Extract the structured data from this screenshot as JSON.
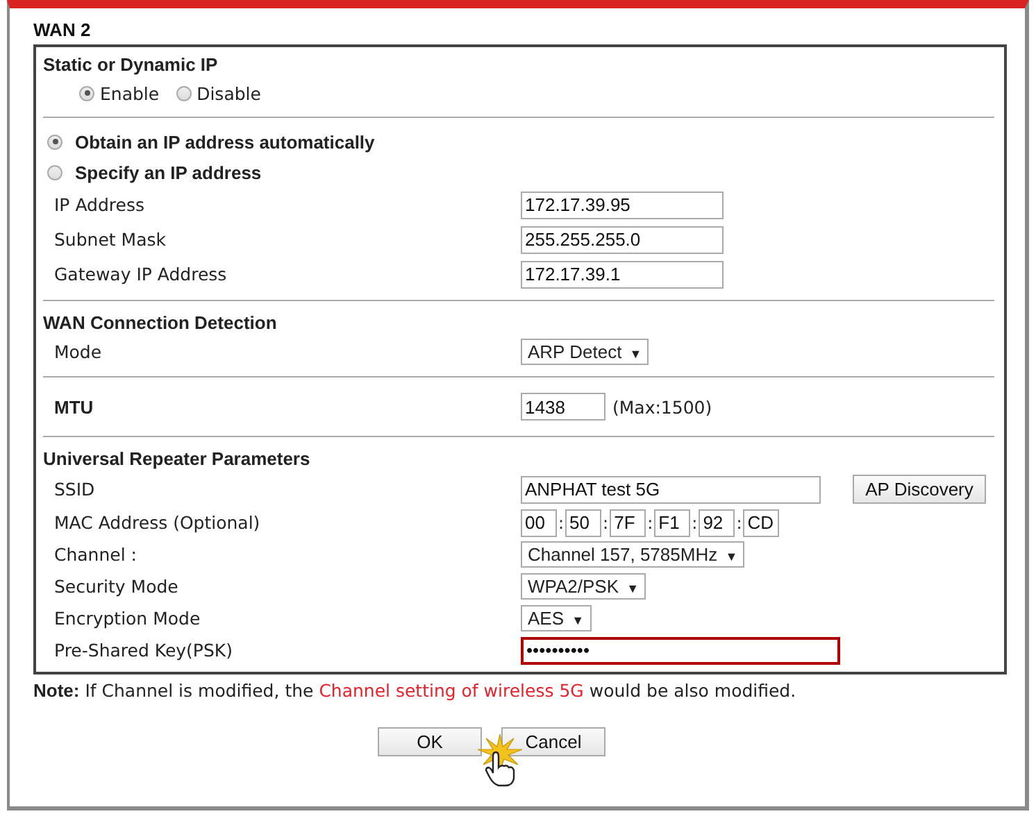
{
  "title": "WAN 2",
  "sections": [
    {
      "heading": "Static or Dynamic IP",
      "rows": [
        {
          "kind": "radio-group",
          "options": [
            {
              "label": "Enable",
              "selected": true
            },
            {
              "label": "Disable",
              "selected": false
            }
          ]
        }
      ]
    },
    {
      "rows": [
        {
          "kind": "radio",
          "label": "Obtain an IP address automatically",
          "selected": true
        },
        {
          "kind": "radio",
          "label": "Specify an IP address",
          "selected": false
        },
        {
          "kind": "text",
          "label": "IP Address",
          "value": "172.17.39.95"
        },
        {
          "kind": "text",
          "label": "Subnet Mask",
          "value": "255.255.255.0"
        },
        {
          "kind": "text",
          "label": "Gateway IP Address",
          "value": "172.17.39.1"
        }
      ]
    },
    {
      "heading": "WAN Connection Detection",
      "rows": [
        {
          "kind": "select",
          "label": "Mode",
          "value": "ARP Detect"
        }
      ]
    },
    {
      "rows": [
        {
          "kind": "number",
          "label": "MTU",
          "value": "1438",
          "hint": "(Max:1500)"
        }
      ]
    },
    {
      "heading": "Universal Repeater Parameters",
      "rows": [
        {
          "kind": "text-button",
          "label": "SSID",
          "value": "ANPHAT test 5G",
          "button": "AP Discovery"
        },
        {
          "kind": "mac",
          "label": "MAC Address (Optional)",
          "parts": [
            "00",
            "50",
            "7F",
            "F1",
            "92",
            "CD"
          ],
          "separator": ":"
        },
        {
          "kind": "select",
          "label": "Channel :",
          "value": "Channel 157, 5785MHz"
        },
        {
          "kind": "select",
          "label": "Security Mode",
          "value": "WPA2/PSK"
        },
        {
          "kind": "select",
          "label": "Encryption Mode",
          "value": "AES"
        },
        {
          "kind": "password",
          "label": "Pre-Shared Key(PSK)",
          "value": "••••••••••",
          "highlighted": true
        }
      ]
    }
  ],
  "note": {
    "label": "Note:",
    "parts": [
      {
        "text": "If Channel is modified, the ",
        "kind": "plain"
      },
      {
        "text": "Channel setting of wireless 5G",
        "kind": "highlight"
      },
      {
        "text": " would be also modified.",
        "kind": "plain"
      }
    ]
  },
  "buttons": [
    "OK",
    "Cancel"
  ],
  "select_arrow": "▼"
}
